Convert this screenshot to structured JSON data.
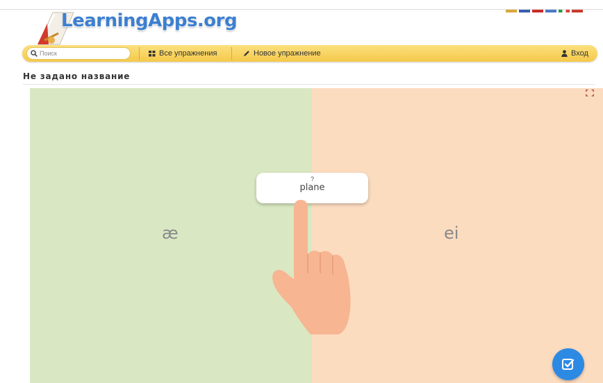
{
  "site": {
    "logo_text": "LearningApps.org",
    "flag_colors": [
      "#d8a93b",
      "#3b5bb0",
      "#cc2a2a",
      "#4a78c8",
      "#2a9a48",
      "#e04040",
      "#c93a2a"
    ]
  },
  "navbar": {
    "search_placeholder": "Поиск",
    "all_exercises_label": "Все упражнения",
    "new_exercise_label": "Новое упражнение",
    "login_label": "Вход"
  },
  "page": {
    "title": "Не задано название"
  },
  "exercise": {
    "left_category": "æ",
    "right_category": "ei",
    "left_color": "#d9e8c3",
    "right_color": "#fcdcbf",
    "card_hint": "?",
    "card_word": "plane"
  },
  "colors": {
    "navbar": "#f5c94a",
    "check_button": "#2d8ae4",
    "logo": "#3c7fd0"
  },
  "icons": {
    "search": "search-icon",
    "grid": "grid-icon",
    "pencil": "pencil-icon",
    "user": "user-icon",
    "fullscreen": "fullscreen-icon",
    "check": "check-icon",
    "hand": "pointing-hand-icon"
  }
}
